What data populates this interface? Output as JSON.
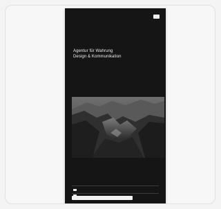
{
  "colors": {
    "canvas": "#f4f4f5",
    "card": "#f7f7f8",
    "phone_background": "#151515",
    "text_primary": "#f0f0f0",
    "text_muted": "#8d8d8d"
  },
  "preview": {
    "header": {
      "logo_text": "",
      "nav_link_text": "",
      "menu_icon": "menu-icon"
    },
    "hero": {
      "title_line1": "Agentur für Wahrung",
      "title_line2": "Design & Kommunikation"
    },
    "image": {
      "description_icon": "mountain-landscape-image"
    },
    "section": {
      "heading": ""
    },
    "rows": [
      {
        "label": "",
        "value": ""
      },
      {
        "label": "",
        "value": ""
      }
    ],
    "cookie_banner": {
      "text": ""
    },
    "footer": {
      "text": "",
      "cta": ""
    }
  }
}
